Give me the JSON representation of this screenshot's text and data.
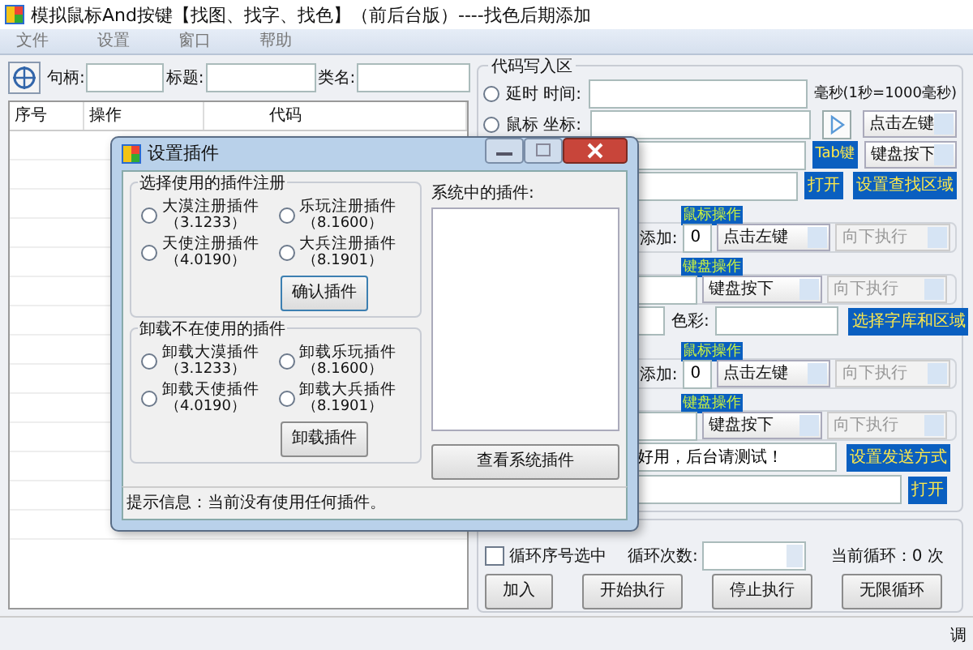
{
  "window": {
    "title": "模拟鼠标And按键【找图、找字、找色】（前后台版）----找色后期添加"
  },
  "menu": [
    "文件",
    "设置",
    "窗口",
    "帮助"
  ],
  "toolbar": {
    "fields": [
      {
        "label": "句柄:"
      },
      {
        "label": "标题:"
      },
      {
        "label": "类名:"
      }
    ]
  },
  "table": {
    "columns": [
      "序号",
      "操作",
      "代码"
    ]
  },
  "code_area": {
    "title": "代码写入区",
    "delay": {
      "label": "延时 时间:",
      "selected": false,
      "unit": "毫秒(1秒=1000毫秒)"
    },
    "mouse": {
      "label": "鼠标 坐标:",
      "selected": false,
      "action": "点击左键"
    },
    "key_row": {
      "button": "Tab键",
      "action": "键盘按下"
    },
    "open_row": {
      "buttons": [
        "打开",
        "设置查找区域"
      ]
    },
    "sections": [
      {
        "kind": "mouse",
        "title": "鼠标操作",
        "label": "添加:",
        "value": "0",
        "action": "点击左键",
        "flow": "向下执行",
        "flow_disabled": true
      },
      {
        "kind": "key",
        "title": "键盘操作",
        "action": "键盘按下",
        "flow": "向下执行",
        "flow_disabled": true
      },
      {
        "kind": "color",
        "label": "色彩:",
        "button": "选择字库和区域"
      },
      {
        "kind": "mouse",
        "title": "鼠标操作",
        "label": "添加:",
        "value": "0",
        "action": "点击左键",
        "flow": "向下执行",
        "flow_disabled": true
      },
      {
        "kind": "key",
        "title": "键盘操作",
        "action": "键盘按下",
        "flow": "向下执行",
        "flow_disabled": true
      },
      {
        "kind": "send",
        "value": "好用，后台请测试！",
        "button": "设置发送方式"
      },
      {
        "kind": "open",
        "button": "打开"
      }
    ]
  },
  "loop": {
    "checkbox": {
      "label": "循环序号选中",
      "checked": false
    },
    "count_label": "循环次数:",
    "current": "当前循环：0 次",
    "buttons": [
      "加入",
      "开始执行",
      "停止执行",
      "无限循环"
    ]
  },
  "status_bar": {
    "text": "调"
  },
  "dialog": {
    "title": "设置插件",
    "register": {
      "title": "选择使用的插件注册",
      "button": "确认插件",
      "options": [
        {
          "name": "大漠注册插件",
          "version": "（3.1233）",
          "selected": false
        },
        {
          "name": "乐玩注册插件",
          "version": "（8.1600）",
          "selected": false
        },
        {
          "name": "天使注册插件",
          "version": "（4.0190）",
          "selected": false
        },
        {
          "name": "大兵注册插件",
          "version": "（8.1901）",
          "selected": false
        }
      ]
    },
    "unload": {
      "title": "卸载不在使用的插件",
      "button": "卸载插件",
      "options": [
        {
          "name": "卸载大漠插件",
          "version": "（3.1233）",
          "selected": false
        },
        {
          "name": "卸载乐玩插件",
          "version": "（8.1600）",
          "selected": false
        },
        {
          "name": "卸载天使插件",
          "version": "（4.0190）",
          "selected": false
        },
        {
          "name": "卸载大兵插件",
          "version": "（8.1901）",
          "selected": false
        }
      ]
    },
    "system": {
      "label": "系统中的插件:",
      "button": "查看系统插件"
    },
    "status": "提示信息：当前没有使用任何插件。"
  }
}
